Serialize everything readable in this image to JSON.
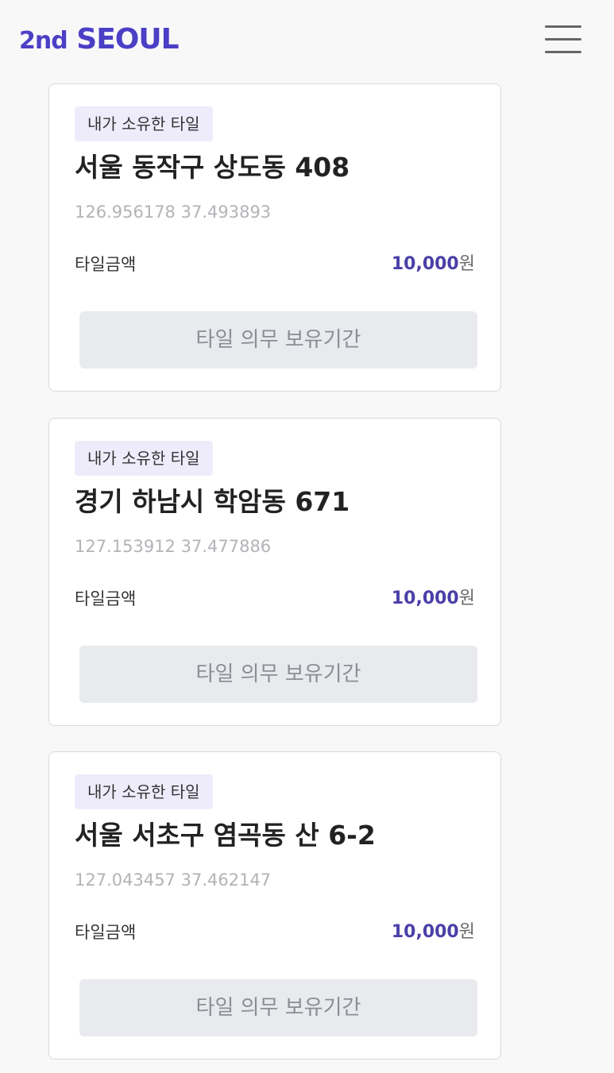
{
  "header": {
    "logo_prefix": "2nd",
    "logo_main": "SEOUL"
  },
  "tiles": [
    {
      "badge": "내가 소유한 타일",
      "address": "서울 동작구 상도동 408",
      "coords": "126.956178 37.493893",
      "amount_label": "타일금액",
      "amount_value": "10,000",
      "amount_unit": "원",
      "button_label": "타일 의무 보유기간"
    },
    {
      "badge": "내가 소유한 타일",
      "address": "경기 하남시 학암동 671",
      "coords": "127.153912 37.477886",
      "amount_label": "타일금액",
      "amount_value": "10,000",
      "amount_unit": "원",
      "button_label": "타일 의무 보유기간"
    },
    {
      "badge": "내가 소유한 타일",
      "address": "서울 서초구 염곡동 산 6-2",
      "coords": "127.043457 37.462147",
      "amount_label": "타일금액",
      "amount_value": "10,000",
      "amount_unit": "원",
      "button_label": "타일 의무 보유기간"
    }
  ],
  "colors": {
    "brand": "#4b3fc6",
    "amount": "#4b3fa8",
    "badge_bg": "#eeecfb",
    "button_bg": "#e8eaed"
  },
  "icons": {
    "menu": "hamburger-menu-icon"
  }
}
